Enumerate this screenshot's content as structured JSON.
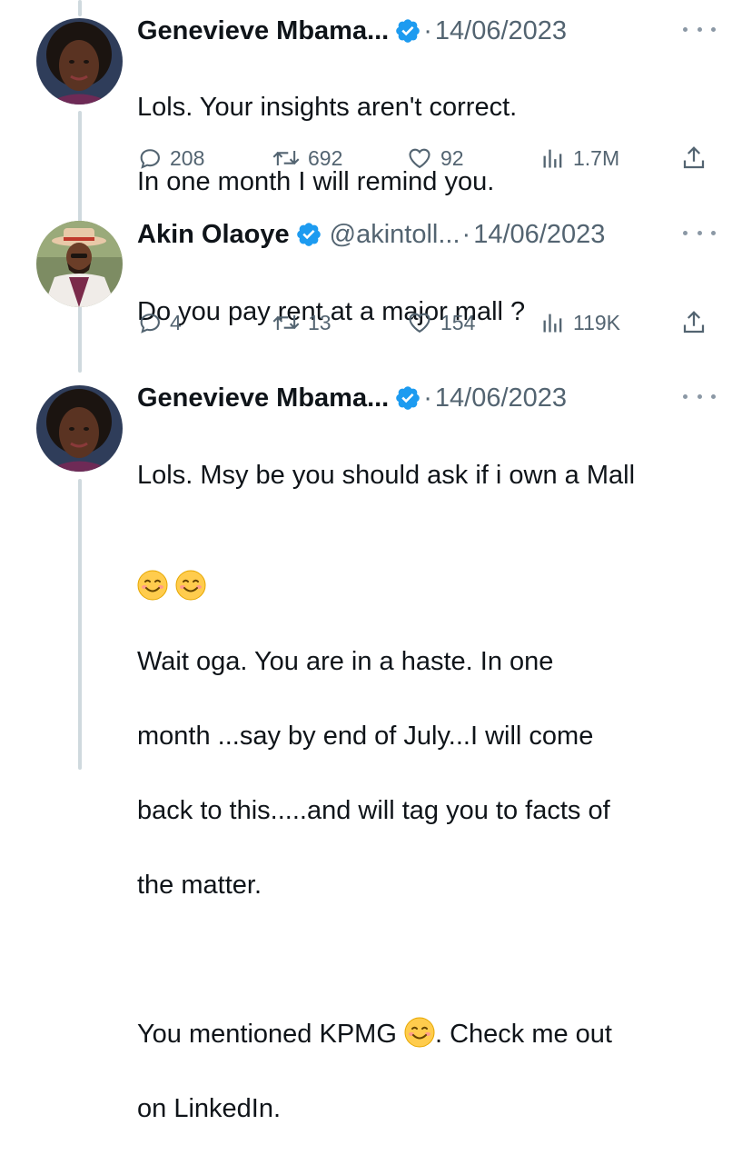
{
  "tweets": [
    {
      "name": "Genevieve Mbama...",
      "handle": "",
      "date": "14/06/2023",
      "lines": [
        "Lols. Your insights aren't correct.",
        "In one month I will remind you."
      ],
      "replies": "208",
      "retweets": "692",
      "likes": "92",
      "views": "1.7M"
    },
    {
      "name": "Akin Olaoye",
      "handle": "@akintoll...",
      "date": "14/06/2023",
      "lines": [
        "Do you pay rent at a major mall ?"
      ],
      "replies": "4",
      "retweets": "13",
      "likes": "154",
      "views": "119K"
    },
    {
      "name": "Genevieve Mbama...",
      "handle": "",
      "date": "14/06/2023",
      "line1": "Lols. Msy be you should ask if i own a Mall",
      "line3": "Wait oga. You are in a haste. In one",
      "line4": "month ...say by end of July...I will come",
      "line5": "back to this.....and will tag you to facts of",
      "line6": "the matter.",
      "line7a": "You mentioned KPMG",
      "line7b": ". Check me out",
      "line8": "on LinkedIn."
    }
  ],
  "colors": {
    "text": "#0f1419",
    "secondary": "#536471",
    "verified": "#1d9bf0",
    "thread_line": "#cfd9de"
  },
  "icons": [
    "reply-icon",
    "retweet-icon",
    "like-icon",
    "views-icon",
    "share-icon",
    "verified-badge-icon",
    "more-icon",
    "smiling-emoji-icon"
  ]
}
